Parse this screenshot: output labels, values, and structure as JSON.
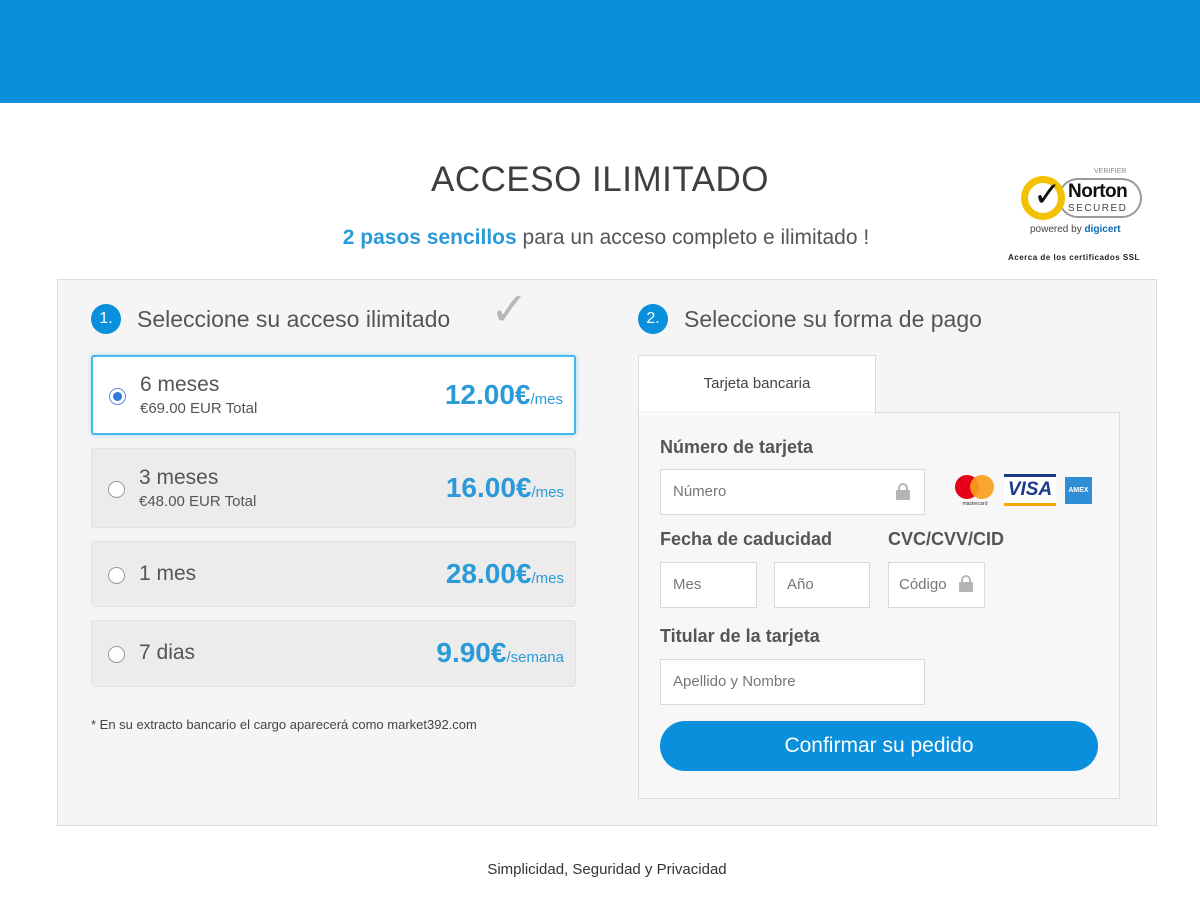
{
  "header": {
    "title": "ACCESO ILIMITADO",
    "subtitle_highlight": "2 pasos sencillos",
    "subtitle_rest": " para un acceso completo e ilimitado !"
  },
  "badge": {
    "verifier": "VERIFIER",
    "brand": "Norton",
    "secured": "SECURED",
    "powered_by": "powered by ",
    "powered_brand": "digicert",
    "about": "Acerca de los certificados SSL"
  },
  "step1": {
    "number": "1.",
    "label": "Seleccione su acceso ilimitado"
  },
  "plans": [
    {
      "name": "6 meses",
      "total": "€69.00 EUR Total",
      "price": "12.00€",
      "unit": "/mes",
      "selected": true
    },
    {
      "name": "3 meses",
      "total": "€48.00 EUR Total",
      "price": "16.00€",
      "unit": "/mes",
      "selected": false
    },
    {
      "name": "1 mes",
      "total": "",
      "price": "28.00€",
      "unit": "/mes",
      "selected": false
    },
    {
      "name": "7 dias",
      "total": "",
      "price": "9.90€",
      "unit": "/semana",
      "selected": false
    }
  ],
  "note": "* En su extracto bancario el cargo aparecerá como market392.com",
  "step2": {
    "number": "2.",
    "label": "Seleccione su forma de pago"
  },
  "payment": {
    "tab": "Tarjeta bancaria",
    "card_number_label": "Número de tarjeta",
    "card_number_placeholder": "Número",
    "expiry_label": "Fecha de caducidad",
    "month_placeholder": "Mes",
    "year_placeholder": "Año",
    "cvc_label": "CVC/CVV/CID",
    "cvc_placeholder": "Código",
    "holder_label": "Titular de la tarjeta",
    "holder_placeholder": "Apellido y Nombre",
    "brands": {
      "mastercard": "mastercard",
      "visa": "VISA",
      "amex": "AMEX"
    },
    "confirm": "Confirmar su pedido"
  },
  "footer": "Simplicidad, Seguridad y Privacidad",
  "colors": {
    "primary": "#0a8fdc",
    "price": "#2b9ad8",
    "selected_border": "#48b8ea"
  }
}
